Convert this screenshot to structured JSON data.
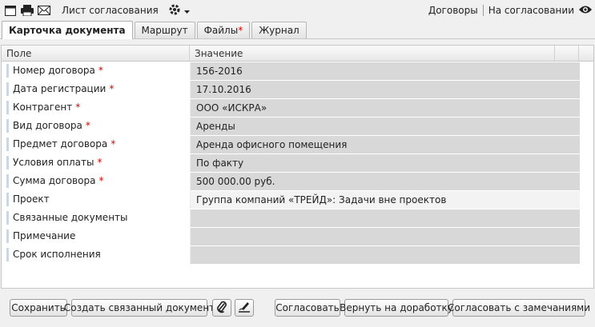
{
  "toolbar": {
    "approval_sheet_label": "Лист согласования",
    "icons": [
      "window-icon",
      "printer-icon",
      "mail-icon",
      "settings-gear-icon",
      "dropdown-arrow-icon",
      "eye-icon"
    ],
    "right_links": {
      "contracts": "Договоры",
      "on_approval": "На согласовании"
    }
  },
  "tabs": [
    {
      "label": "Карточка документа",
      "active": true,
      "required": false
    },
    {
      "label": "Маршрут",
      "active": false,
      "required": false
    },
    {
      "label": "Файлы",
      "active": false,
      "required": true
    },
    {
      "label": "Журнал",
      "active": false,
      "required": false
    }
  ],
  "grid": {
    "headers": {
      "field": "Поле",
      "value": "Значение"
    },
    "rows": [
      {
        "label": "Номер договора",
        "required": true,
        "value": "156-2016"
      },
      {
        "label": "Дата регистрации",
        "required": true,
        "value": "17.10.2016"
      },
      {
        "label": "Контрагент",
        "required": true,
        "value": "ООО «ИСКРА»"
      },
      {
        "label": "Вид договора",
        "required": true,
        "value": "Аренды"
      },
      {
        "label": "Предмет договора",
        "required": true,
        "value": "Аренда офисного помещения"
      },
      {
        "label": "Условия оплаты",
        "required": true,
        "value": "По факту"
      },
      {
        "label": "Сумма договора",
        "required": true,
        "value": "500 000.00 руб."
      },
      {
        "label": "Проект",
        "required": false,
        "value": "Группа компаний «ТРЕЙД»: Задачи вне проектов"
      },
      {
        "label": "Связанные документы",
        "required": false,
        "value": ""
      },
      {
        "label": "Примечание",
        "required": false,
        "value": ""
      },
      {
        "label": "Срок исполнения",
        "required": false,
        "value": ""
      }
    ],
    "required_mark": "*"
  },
  "buttons": {
    "save": "Сохранить",
    "create_related": "Создать связанный документ",
    "approve": "Согласовать",
    "return": "Вернуть на доработку",
    "approve_with_remarks": "Согласовать с замечаниями"
  },
  "colors": {
    "required": "#dd0000",
    "value_cell": "#d8d8d8",
    "value_cell_light": "#f3f3f3",
    "background": "#f0f0f0"
  }
}
